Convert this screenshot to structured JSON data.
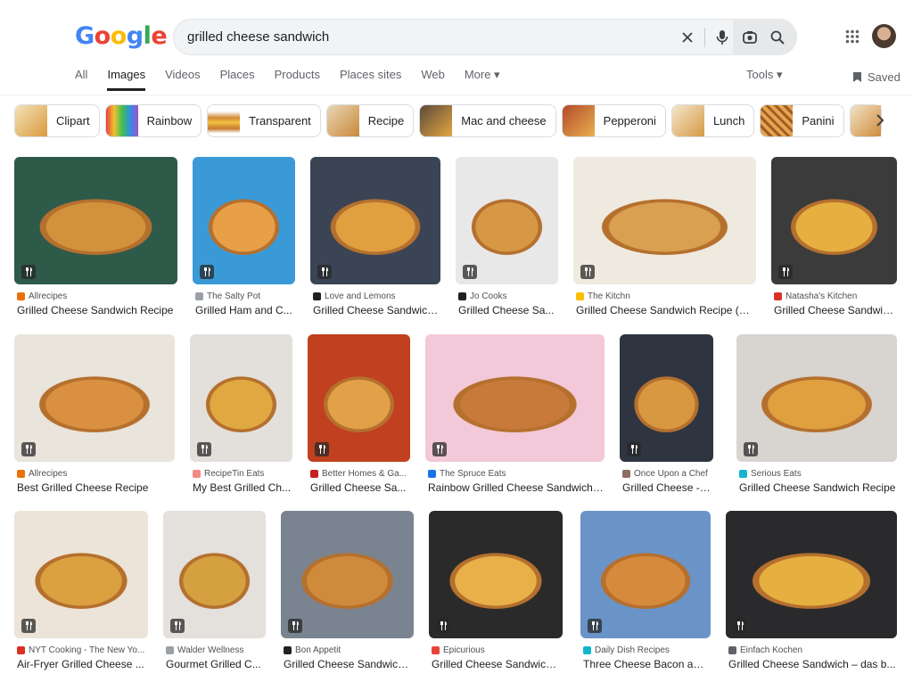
{
  "logo_letters": [
    "G",
    "o",
    "o",
    "g",
    "l",
    "e"
  ],
  "search": {
    "query": "grilled cheese sandwich"
  },
  "icons": [
    "clear-icon",
    "mic-icon",
    "lens-icon",
    "search-icon",
    "apps-icon",
    "saved-icon",
    "chevron-right-icon",
    "utensils-icon"
  ],
  "nav": {
    "tabs": [
      "All",
      "Images",
      "Videos",
      "Places",
      "Products",
      "Places sites",
      "Web",
      "More ▾"
    ],
    "active": "Images",
    "tools": "Tools ▾",
    "saved": "Saved"
  },
  "chips": [
    "Clipart",
    "Rainbow",
    "Transparent",
    "Recipe",
    "Mac and cheese",
    "Pepperoni",
    "Lunch",
    "Panini"
  ],
  "results": [
    {
      "source": "Allrecipes",
      "title": "Grilled Cheese Sandwich Recipe",
      "fav": "#e8710a"
    },
    {
      "source": "The Salty Pot",
      "title": "Grilled Ham and C...",
      "fav": "#9aa0a6"
    },
    {
      "source": "Love and Lemons",
      "title": "Grilled Cheese Sandwich...",
      "fav": "#202124"
    },
    {
      "source": "Jo Cooks",
      "title": "Grilled Cheese Sa...",
      "fav": "#202124"
    },
    {
      "source": "The Kitchn",
      "title": "Grilled Cheese Sandwich Recipe (M...",
      "fav": "#fbbc05"
    },
    {
      "source": "Natasha's Kitchen",
      "title": "Grilled Cheese Sandwic...",
      "fav": "#d93025"
    },
    {
      "source": "Allrecipes",
      "title": "Best Grilled Cheese Recipe",
      "fav": "#e8710a"
    },
    {
      "source": "RecipeTin Eats",
      "title": "My Best Grilled Ch...",
      "fav": "#f28b82"
    },
    {
      "source": "Better Homes & Ga...",
      "title": "Grilled Cheese Sa...",
      "fav": "#c5221f"
    },
    {
      "source": "The Spruce Eats",
      "title": "Rainbow Grilled Cheese Sandwich ...",
      "fav": "#1a73e8"
    },
    {
      "source": "Once Upon a Chef",
      "title": "Grilled Cheese - O...",
      "fav": "#8d6e63"
    },
    {
      "source": "Serious Eats",
      "title": "Grilled Cheese Sandwich Recipe",
      "fav": "#12b5cb"
    },
    {
      "source": "NYT Cooking - The New Yo...",
      "title": "Air-Fryer Grilled Cheese ...",
      "fav": "#d93025"
    },
    {
      "source": "Walder Wellness",
      "title": "Gourmet Grilled C...",
      "fav": "#9aa0a6"
    },
    {
      "source": "Bon Appetit",
      "title": "Grilled Cheese Sandwich ...",
      "fav": "#202124"
    },
    {
      "source": "Epicurious",
      "title": "Grilled Cheese Sandwich ...",
      "fav": "#ea4335"
    },
    {
      "source": "Daily Dish Recipes",
      "title": "Three Cheese Bacon and...",
      "fav": "#12b5cb"
    },
    {
      "source": "Einfach Kochen",
      "title": "Grilled Cheese Sandwich – das b...",
      "fav": "#5f6368"
    }
  ]
}
